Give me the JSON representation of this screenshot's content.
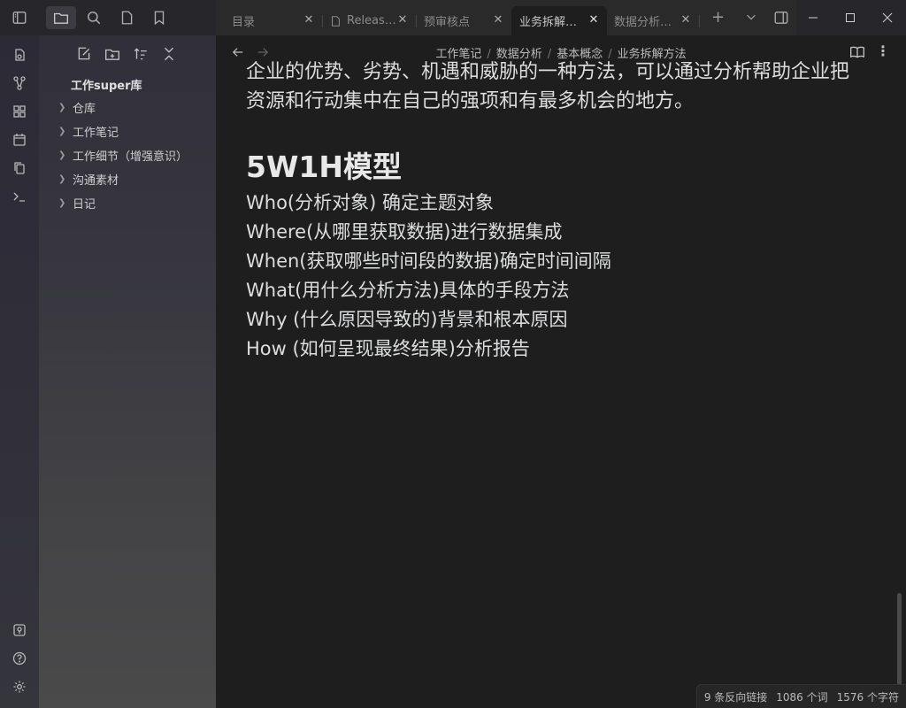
{
  "tabs": [
    {
      "label": "目录",
      "active": false
    },
    {
      "label": "Releas…",
      "active": false
    },
    {
      "label": "预审核点",
      "active": false
    },
    {
      "label": "业务拆解…",
      "active": true
    },
    {
      "label": "数据分析…",
      "active": false
    }
  ],
  "breadcrumb": [
    "工作笔记",
    "数据分析",
    "基本概念",
    "业务拆解方法"
  ],
  "vault": {
    "name": "工作super库",
    "folders": [
      "仓库",
      "工作笔记",
      "工作细节（增强意识）",
      "沟通素材",
      "日记"
    ]
  },
  "content": {
    "para_line1": "企业的优势、劣势、机遇和威胁的一种方法，可以通过分析帮助企业把",
    "para_line2": "资源和行动集中在自己的强项和有最多机会的地方。",
    "heading": "5W1H模型",
    "lines": [
      "Who(分析对象) 确定主题对象",
      "Where(从哪里获取数据)进行数据集成",
      "When(获取哪些时间段的数据)确定时间间隔",
      "What(用什么分析方法)具体的手段方法",
      "Why (什么原因导致的)背景和根本原因",
      "How (如何呈现最终结果)分析报告"
    ]
  },
  "status": {
    "backlinks": "9 条反向链接",
    "words": "1086 个词",
    "chars": "1576 个字符"
  }
}
